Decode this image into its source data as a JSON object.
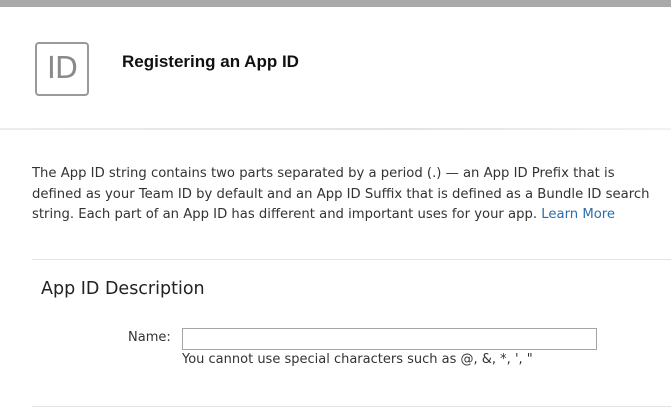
{
  "header": {
    "badge_text": "ID",
    "title": "Registering an App ID"
  },
  "intro": {
    "text": "The App ID string contains two parts separated by a period (.) — an App ID Prefix that is defined as your Team ID by default and an App ID Suffix that is defined as a Bundle ID search string. Each part of an App ID has different and important uses for your app.",
    "link_label": "Learn More"
  },
  "description_section": {
    "title": "App ID Description",
    "name_label": "Name:",
    "name_value": "",
    "name_hint": "You cannot use special characters such as @, &, *, ', \""
  },
  "colors": {
    "top_bar": "#a9a9a9",
    "link": "#2d6da9",
    "badge_border": "#9a9a9a"
  }
}
